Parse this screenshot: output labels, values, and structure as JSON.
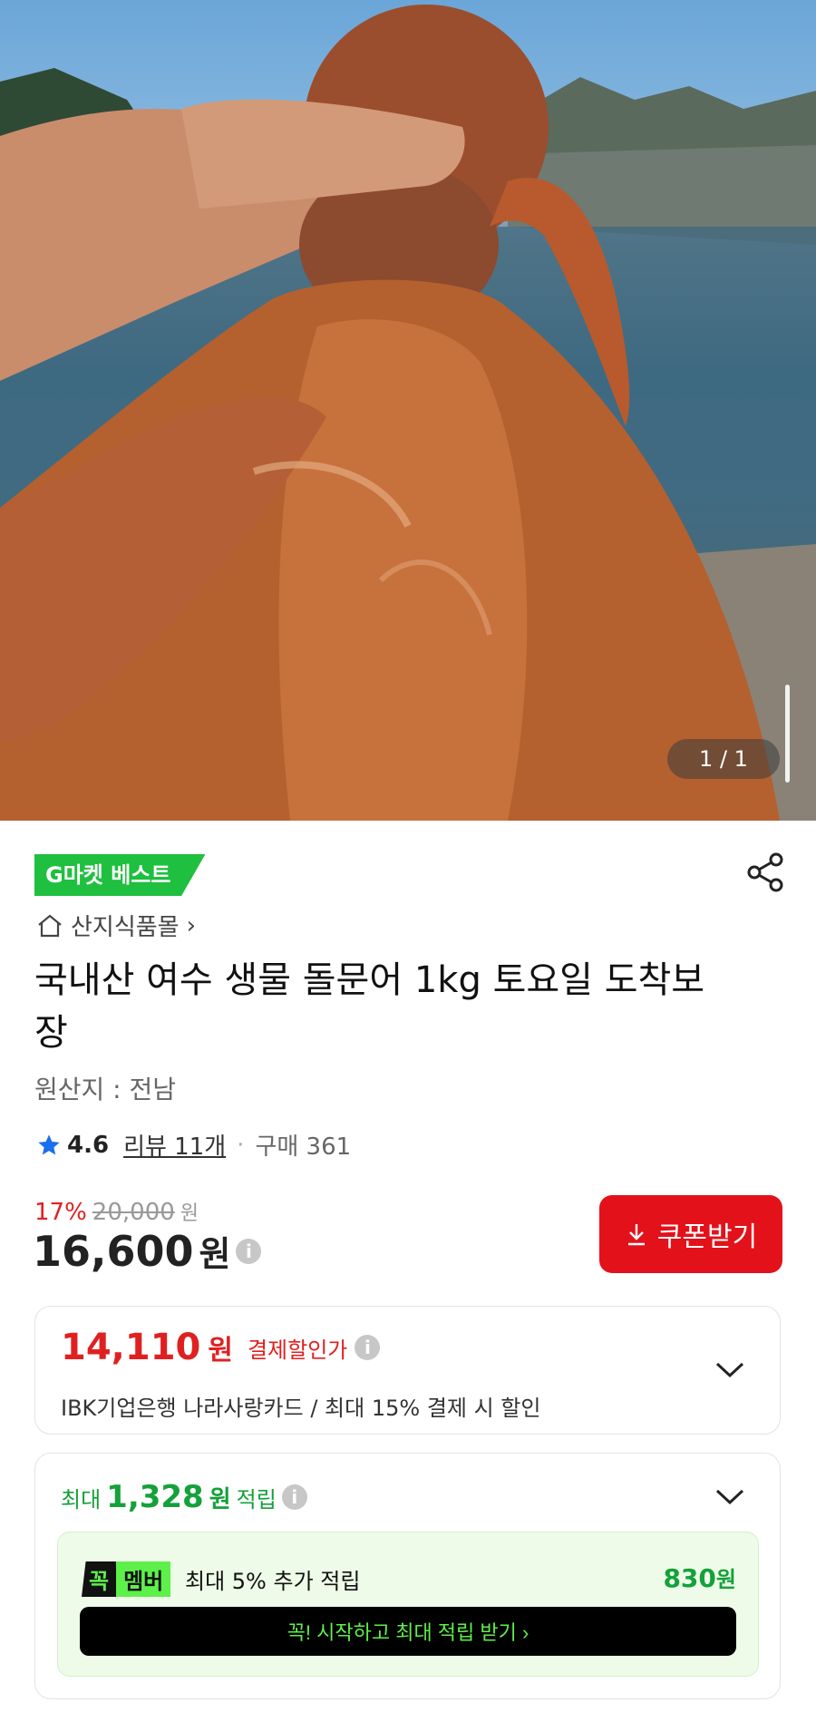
{
  "gallery": {
    "counter": "1 / 1"
  },
  "product": {
    "badge": "G마켓 베스트",
    "store": "산지식품몰",
    "store_chevron": "›",
    "title": "국내산 여수 생물 돌문어 1kg 토요일 도착보장",
    "origin": "원산지 : 전남",
    "rating": "4.6",
    "review": "리뷰 11개",
    "purchases": "구매 361"
  },
  "pricing": {
    "discount_pct": "17%",
    "original_price": "20,000",
    "original_unit": "원",
    "price": "16,600",
    "price_unit": "원",
    "coupon_button": "쿠폰받기"
  },
  "payment_discount": {
    "amount": "14,110",
    "unit": "원",
    "label": "결제할인가",
    "description": "IBK기업은행 나라사랑카드 / 최대 15% 결제 시 할인"
  },
  "points": {
    "prefix": "최대",
    "amount": "1,328",
    "unit": "원",
    "suffix": "적립",
    "member_tag_1": "꼭",
    "member_tag_2": "멤버",
    "member_text": "최대 5% 추가 적립",
    "member_amount": "830",
    "member_unit": "원",
    "start_button": "꼭! 시작하고 최대 적립 받기 ›"
  },
  "colors": {
    "accent_red": "#e3111a",
    "accent_green": "#14a13a",
    "badge_green": "#1fbf3f"
  },
  "icons": [
    "share-icon",
    "home-icon",
    "star-icon",
    "info-icon",
    "download-icon",
    "chevron-down-icon"
  ]
}
